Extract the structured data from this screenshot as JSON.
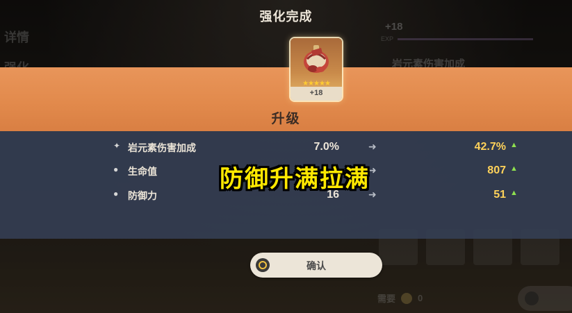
{
  "screen": {
    "title": "强化完成",
    "upgrade_label": "升级",
    "overlay_caption": "防御升满拉满"
  },
  "artifact": {
    "stars": "★★★★★",
    "level": "+18"
  },
  "stats": [
    {
      "name": "岩元素伤害加成",
      "old": "7.0%",
      "new": "42.7%"
    },
    {
      "name": "生命值",
      "old": "",
      "new": "807"
    },
    {
      "name": "防御力",
      "old": "16",
      "new": "51"
    }
  ],
  "confirm": {
    "label": "确认"
  },
  "background": {
    "left_tabs": [
      "详情",
      "强化"
    ],
    "level": "+18",
    "exp_label": "EXP",
    "stat": "岩元素伤害加成",
    "cost_label": "需要",
    "cost_value": "0"
  },
  "colors": {
    "band": "#e28a4c",
    "panel": "#343e52",
    "value_highlight": "#ffd25a",
    "up_arrow": "#8ee04f",
    "caption": "#ffe800"
  }
}
